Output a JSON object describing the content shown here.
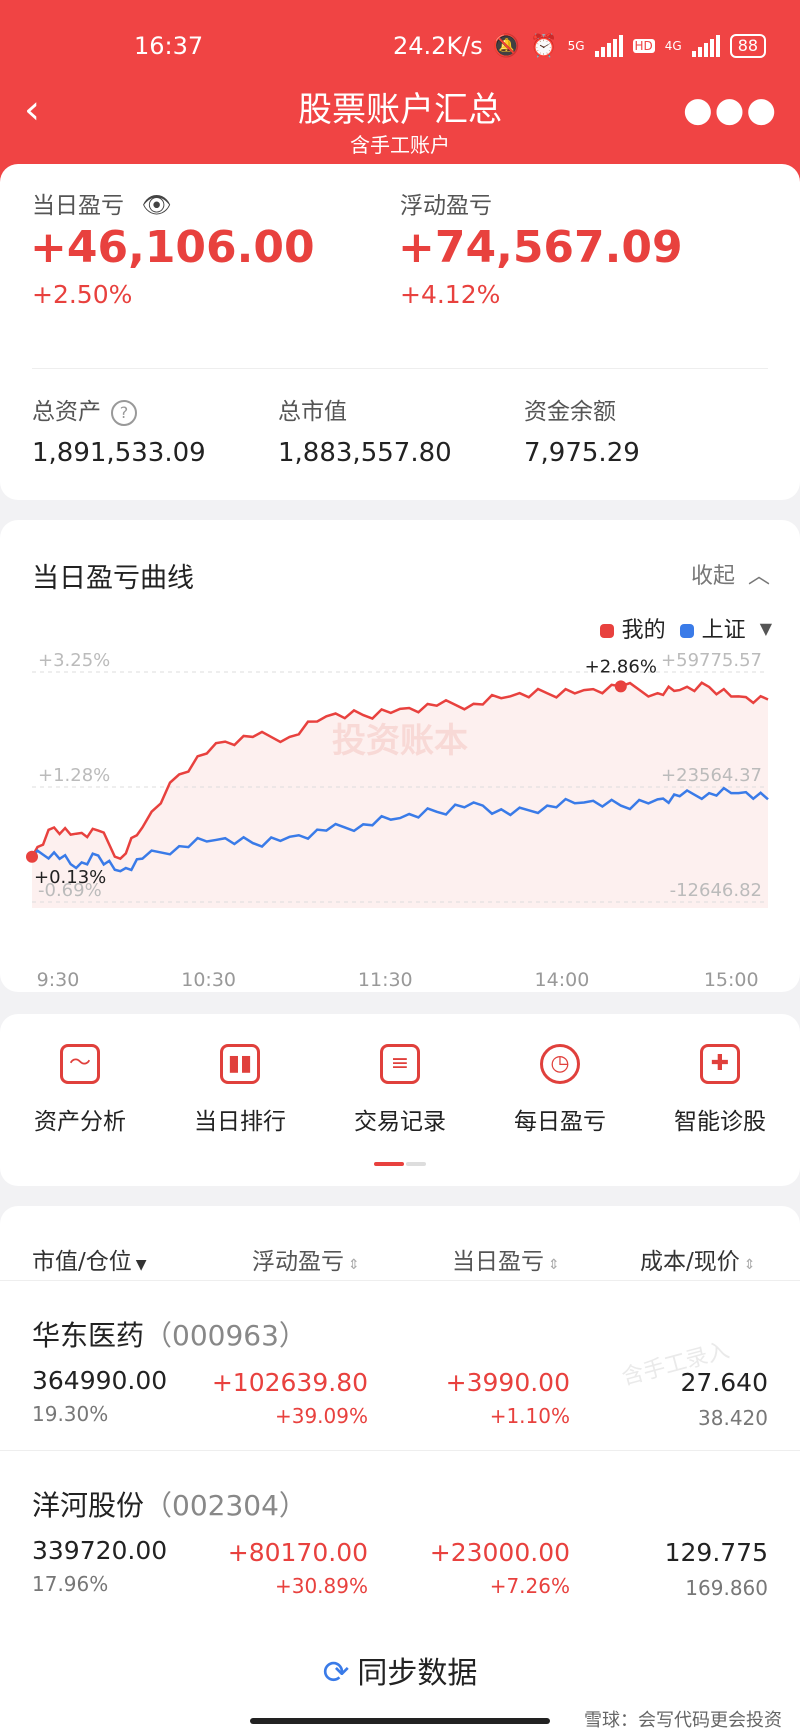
{
  "status_bar": {
    "time": "16:37",
    "speed": "24.2K/s",
    "net1": "5G",
    "hd": "HD",
    "net2": "4G",
    "battery": "88"
  },
  "nav": {
    "title": "股票账户汇总",
    "subtitle": "含手工账户",
    "back_icon": "chevron-left-icon",
    "more_icon": "more-dots-icon"
  },
  "summary": {
    "daily_pl_label": "当日盈亏",
    "daily_pl_value": "+46,106.00",
    "daily_pl_pct": "+2.50%",
    "float_pl_label": "浮动盈亏",
    "float_pl_value": "+74,567.09",
    "float_pl_pct": "+4.12%",
    "total_assets_label": "总资产",
    "total_assets_value": "1,891,533.09",
    "market_value_label": "总市值",
    "market_value_value": "1,883,557.80",
    "cash_label": "资金余额",
    "cash_value": "7,975.29",
    "help_symbol": "?"
  },
  "chart_section": {
    "title": "当日盈亏曲线",
    "collapse_label": "收起",
    "watermark": "投资账本",
    "callout_max": "+2.86%",
    "callout_start": "+0.13%"
  },
  "chart_data": {
    "type": "line",
    "x_ticks": [
      "9:30",
      "10:30",
      "11:30",
      "14:00",
      "15:00"
    ],
    "y_left_ticks": [
      "+3.25%",
      "+1.28%",
      "-0.69%"
    ],
    "y_right_ticks": [
      "+59775.57",
      "+23564.37",
      "-12646.82"
    ],
    "ylim_pct": [
      -0.69,
      3.25
    ],
    "series": [
      {
        "name": "我的",
        "color": "#e8413e",
        "x": [
          0,
          0.03,
          0.06,
          0.09,
          0.12,
          0.15,
          0.2,
          0.25,
          0.3,
          0.35,
          0.4,
          0.45,
          0.5,
          0.55,
          0.6,
          0.65,
          0.7,
          0.75,
          0.8,
          0.85,
          0.88,
          0.92,
          0.96,
          1.0
        ],
        "y": [
          0.13,
          0.6,
          0.5,
          0.55,
          0.1,
          0.6,
          1.45,
          1.95,
          2.05,
          2.05,
          2.38,
          2.4,
          2.5,
          2.55,
          2.58,
          2.7,
          2.75,
          2.8,
          2.86,
          2.75,
          2.8,
          2.85,
          2.7,
          2.65
        ]
      },
      {
        "name": "上证",
        "color": "#3a7be8",
        "x": [
          0,
          0.03,
          0.06,
          0.09,
          0.12,
          0.15,
          0.2,
          0.25,
          0.3,
          0.35,
          0.4,
          0.45,
          0.5,
          0.55,
          0.6,
          0.65,
          0.7,
          0.75,
          0.8,
          0.85,
          0.88,
          0.92,
          0.96,
          1.0
        ],
        "y": [
          0.13,
          0.2,
          -0.05,
          0.15,
          -0.1,
          0.1,
          0.3,
          0.4,
          0.35,
          0.45,
          0.55,
          0.65,
          0.75,
          0.85,
          1.0,
          0.8,
          0.95,
          1.0,
          0.95,
          1.05,
          1.1,
          1.15,
          1.15,
          1.05
        ]
      }
    ]
  },
  "functions": [
    {
      "label": "资产分析",
      "icon": "chart-line-icon"
    },
    {
      "label": "当日排行",
      "icon": "bar-chart-icon"
    },
    {
      "label": "交易记录",
      "icon": "document-icon"
    },
    {
      "label": "每日盈亏",
      "icon": "clock-icon"
    },
    {
      "label": "智能诊股",
      "icon": "medical-kit-icon"
    }
  ],
  "table": {
    "headers": [
      "市值/仓位",
      "浮动盈亏",
      "当日盈亏",
      "成本/现价"
    ],
    "watermark": "含手工录入",
    "rows": [
      {
        "name": "华东医药",
        "code": "（000963）",
        "market_value": "364990.00",
        "position": "19.30%",
        "float_pl": "+102639.80",
        "float_pct": "+39.09%",
        "daily_pl": "+3990.00",
        "daily_pct": "+1.10%",
        "cost": "27.640",
        "price": "38.420"
      },
      {
        "name": "洋河股份",
        "code": "（002304）",
        "market_value": "339720.00",
        "position": "17.96%",
        "float_pl": "+80170.00",
        "float_pct": "+30.89%",
        "daily_pl": "+23000.00",
        "daily_pct": "+7.26%",
        "cost": "129.775",
        "price": "169.860"
      }
    ]
  },
  "bottom": {
    "sync_label": "同步数据",
    "xueqiu_mark": "雪球：会写代码更会投资"
  }
}
